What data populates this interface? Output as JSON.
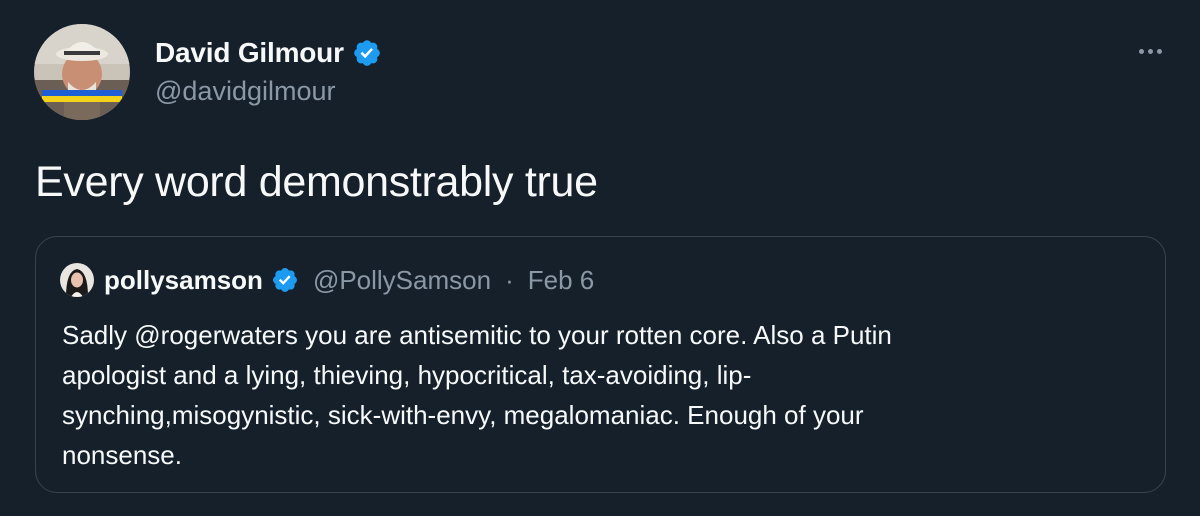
{
  "author": {
    "display_name": "David Gilmour",
    "handle": "@davidgilmour",
    "verified_icon": "verified-badge-icon"
  },
  "tweet": {
    "text": "Every word demonstrably true"
  },
  "menu": {
    "icon": "more-options-icon"
  },
  "quoted": {
    "display_name": "pollysamson",
    "handle": "@PollySamson",
    "separator": "·",
    "date": "Feb 6",
    "text_lines": [
      "Sadly @rogerwaters you are antisemitic to your rotten core. Also a Putin",
      "apologist and a lying, thieving, hypocritical, tax-avoiding, lip-",
      "synching,misogynistic, sick-with-envy, megalomaniac. Enough of your",
      "nonsense."
    ]
  },
  "colors": {
    "background": "#15202b",
    "text_primary": "#f7f9f9",
    "text_secondary": "#8b98a5",
    "border": "#38444d",
    "verified_blue": "#1d9bf0"
  }
}
